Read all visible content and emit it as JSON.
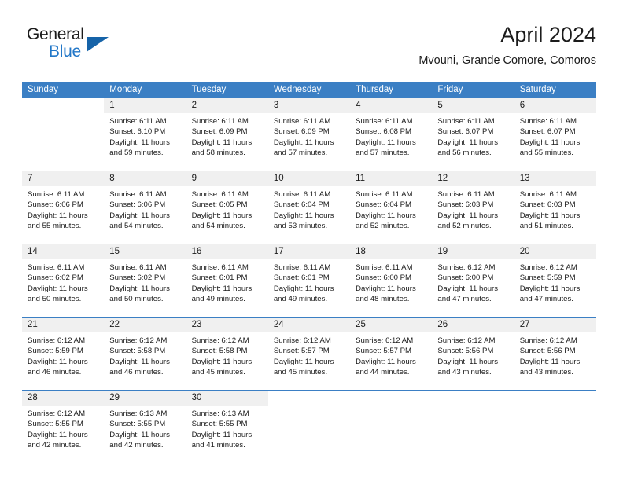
{
  "brand": {
    "name_top": "General",
    "name_bottom": "Blue",
    "accent_color": "#2277c8",
    "triangle_color": "#1663a8",
    "logo_icon": "blue-triangle-icon"
  },
  "header": {
    "title": "April 2024",
    "subtitle": "Mvouni, Grande Comore, Comoros"
  },
  "theme": {
    "header_blue": "#3b7fc4",
    "band_gray": "#f0f0f0",
    "text": "#1b1b1b"
  },
  "weekdays": [
    "Sunday",
    "Monday",
    "Tuesday",
    "Wednesday",
    "Thursday",
    "Friday",
    "Saturday"
  ],
  "weeks": [
    [
      {
        "day": "",
        "sunrise": "",
        "sunset": "",
        "daylight1": "",
        "daylight2": "",
        "blank": true
      },
      {
        "day": "1",
        "sunrise": "Sunrise: 6:11 AM",
        "sunset": "Sunset: 6:10 PM",
        "daylight1": "Daylight: 11 hours",
        "daylight2": "and 59 minutes."
      },
      {
        "day": "2",
        "sunrise": "Sunrise: 6:11 AM",
        "sunset": "Sunset: 6:09 PM",
        "daylight1": "Daylight: 11 hours",
        "daylight2": "and 58 minutes."
      },
      {
        "day": "3",
        "sunrise": "Sunrise: 6:11 AM",
        "sunset": "Sunset: 6:09 PM",
        "daylight1": "Daylight: 11 hours",
        "daylight2": "and 57 minutes."
      },
      {
        "day": "4",
        "sunrise": "Sunrise: 6:11 AM",
        "sunset": "Sunset: 6:08 PM",
        "daylight1": "Daylight: 11 hours",
        "daylight2": "and 57 minutes."
      },
      {
        "day": "5",
        "sunrise": "Sunrise: 6:11 AM",
        "sunset": "Sunset: 6:07 PM",
        "daylight1": "Daylight: 11 hours",
        "daylight2": "and 56 minutes."
      },
      {
        "day": "6",
        "sunrise": "Sunrise: 6:11 AM",
        "sunset": "Sunset: 6:07 PM",
        "daylight1": "Daylight: 11 hours",
        "daylight2": "and 55 minutes."
      }
    ],
    [
      {
        "day": "7",
        "sunrise": "Sunrise: 6:11 AM",
        "sunset": "Sunset: 6:06 PM",
        "daylight1": "Daylight: 11 hours",
        "daylight2": "and 55 minutes."
      },
      {
        "day": "8",
        "sunrise": "Sunrise: 6:11 AM",
        "sunset": "Sunset: 6:06 PM",
        "daylight1": "Daylight: 11 hours",
        "daylight2": "and 54 minutes."
      },
      {
        "day": "9",
        "sunrise": "Sunrise: 6:11 AM",
        "sunset": "Sunset: 6:05 PM",
        "daylight1": "Daylight: 11 hours",
        "daylight2": "and 54 minutes."
      },
      {
        "day": "10",
        "sunrise": "Sunrise: 6:11 AM",
        "sunset": "Sunset: 6:04 PM",
        "daylight1": "Daylight: 11 hours",
        "daylight2": "and 53 minutes."
      },
      {
        "day": "11",
        "sunrise": "Sunrise: 6:11 AM",
        "sunset": "Sunset: 6:04 PM",
        "daylight1": "Daylight: 11 hours",
        "daylight2": "and 52 minutes."
      },
      {
        "day": "12",
        "sunrise": "Sunrise: 6:11 AM",
        "sunset": "Sunset: 6:03 PM",
        "daylight1": "Daylight: 11 hours",
        "daylight2": "and 52 minutes."
      },
      {
        "day": "13",
        "sunrise": "Sunrise: 6:11 AM",
        "sunset": "Sunset: 6:03 PM",
        "daylight1": "Daylight: 11 hours",
        "daylight2": "and 51 minutes."
      }
    ],
    [
      {
        "day": "14",
        "sunrise": "Sunrise: 6:11 AM",
        "sunset": "Sunset: 6:02 PM",
        "daylight1": "Daylight: 11 hours",
        "daylight2": "and 50 minutes."
      },
      {
        "day": "15",
        "sunrise": "Sunrise: 6:11 AM",
        "sunset": "Sunset: 6:02 PM",
        "daylight1": "Daylight: 11 hours",
        "daylight2": "and 50 minutes."
      },
      {
        "day": "16",
        "sunrise": "Sunrise: 6:11 AM",
        "sunset": "Sunset: 6:01 PM",
        "daylight1": "Daylight: 11 hours",
        "daylight2": "and 49 minutes."
      },
      {
        "day": "17",
        "sunrise": "Sunrise: 6:11 AM",
        "sunset": "Sunset: 6:01 PM",
        "daylight1": "Daylight: 11 hours",
        "daylight2": "and 49 minutes."
      },
      {
        "day": "18",
        "sunrise": "Sunrise: 6:11 AM",
        "sunset": "Sunset: 6:00 PM",
        "daylight1": "Daylight: 11 hours",
        "daylight2": "and 48 minutes."
      },
      {
        "day": "19",
        "sunrise": "Sunrise: 6:12 AM",
        "sunset": "Sunset: 6:00 PM",
        "daylight1": "Daylight: 11 hours",
        "daylight2": "and 47 minutes."
      },
      {
        "day": "20",
        "sunrise": "Sunrise: 6:12 AM",
        "sunset": "Sunset: 5:59 PM",
        "daylight1": "Daylight: 11 hours",
        "daylight2": "and 47 minutes."
      }
    ],
    [
      {
        "day": "21",
        "sunrise": "Sunrise: 6:12 AM",
        "sunset": "Sunset: 5:59 PM",
        "daylight1": "Daylight: 11 hours",
        "daylight2": "and 46 minutes."
      },
      {
        "day": "22",
        "sunrise": "Sunrise: 6:12 AM",
        "sunset": "Sunset: 5:58 PM",
        "daylight1": "Daylight: 11 hours",
        "daylight2": "and 46 minutes."
      },
      {
        "day": "23",
        "sunrise": "Sunrise: 6:12 AM",
        "sunset": "Sunset: 5:58 PM",
        "daylight1": "Daylight: 11 hours",
        "daylight2": "and 45 minutes."
      },
      {
        "day": "24",
        "sunrise": "Sunrise: 6:12 AM",
        "sunset": "Sunset: 5:57 PM",
        "daylight1": "Daylight: 11 hours",
        "daylight2": "and 45 minutes."
      },
      {
        "day": "25",
        "sunrise": "Sunrise: 6:12 AM",
        "sunset": "Sunset: 5:57 PM",
        "daylight1": "Daylight: 11 hours",
        "daylight2": "and 44 minutes."
      },
      {
        "day": "26",
        "sunrise": "Sunrise: 6:12 AM",
        "sunset": "Sunset: 5:56 PM",
        "daylight1": "Daylight: 11 hours",
        "daylight2": "and 43 minutes."
      },
      {
        "day": "27",
        "sunrise": "Sunrise: 6:12 AM",
        "sunset": "Sunset: 5:56 PM",
        "daylight1": "Daylight: 11 hours",
        "daylight2": "and 43 minutes."
      }
    ],
    [
      {
        "day": "28",
        "sunrise": "Sunrise: 6:12 AM",
        "sunset": "Sunset: 5:55 PM",
        "daylight1": "Daylight: 11 hours",
        "daylight2": "and 42 minutes."
      },
      {
        "day": "29",
        "sunrise": "Sunrise: 6:13 AM",
        "sunset": "Sunset: 5:55 PM",
        "daylight1": "Daylight: 11 hours",
        "daylight2": "and 42 minutes."
      },
      {
        "day": "30",
        "sunrise": "Sunrise: 6:13 AM",
        "sunset": "Sunset: 5:55 PM",
        "daylight1": "Daylight: 11 hours",
        "daylight2": "and 41 minutes."
      },
      {
        "day": "",
        "sunrise": "",
        "sunset": "",
        "daylight1": "",
        "daylight2": "",
        "blank": true
      },
      {
        "day": "",
        "sunrise": "",
        "sunset": "",
        "daylight1": "",
        "daylight2": "",
        "blank": true
      },
      {
        "day": "",
        "sunrise": "",
        "sunset": "",
        "daylight1": "",
        "daylight2": "",
        "blank": true
      },
      {
        "day": "",
        "sunrise": "",
        "sunset": "",
        "daylight1": "",
        "daylight2": "",
        "blank": true
      }
    ]
  ]
}
